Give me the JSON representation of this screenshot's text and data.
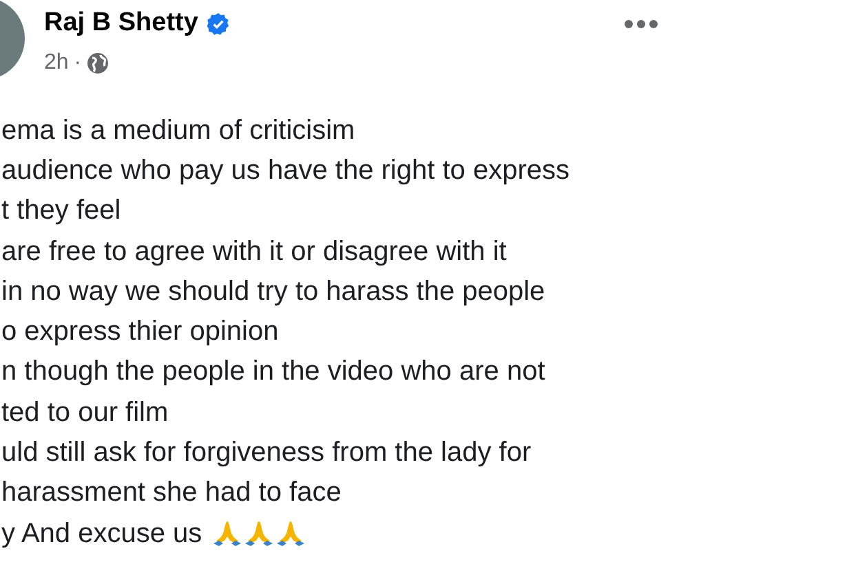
{
  "post": {
    "author": "Raj B Shetty",
    "verified": true,
    "time": "2h",
    "separator": "·",
    "lines": [
      "ema is a medium of criticisim",
      "audience who pay us have the right to express",
      "t they feel",
      "are free to agree with it or disagree with it",
      "in no way we should try to harass the people",
      "o express thier opinion",
      "n though the people in the video who are not",
      "ted to our film",
      "uld still ask for forgiveness from the lady for",
      "harassment she had to face",
      "y And excuse us"
    ],
    "trailing_icons": [
      {
        "kind": "praying-hands"
      },
      {
        "kind": "praying-hands"
      },
      {
        "kind": "praying-hands"
      }
    ]
  }
}
